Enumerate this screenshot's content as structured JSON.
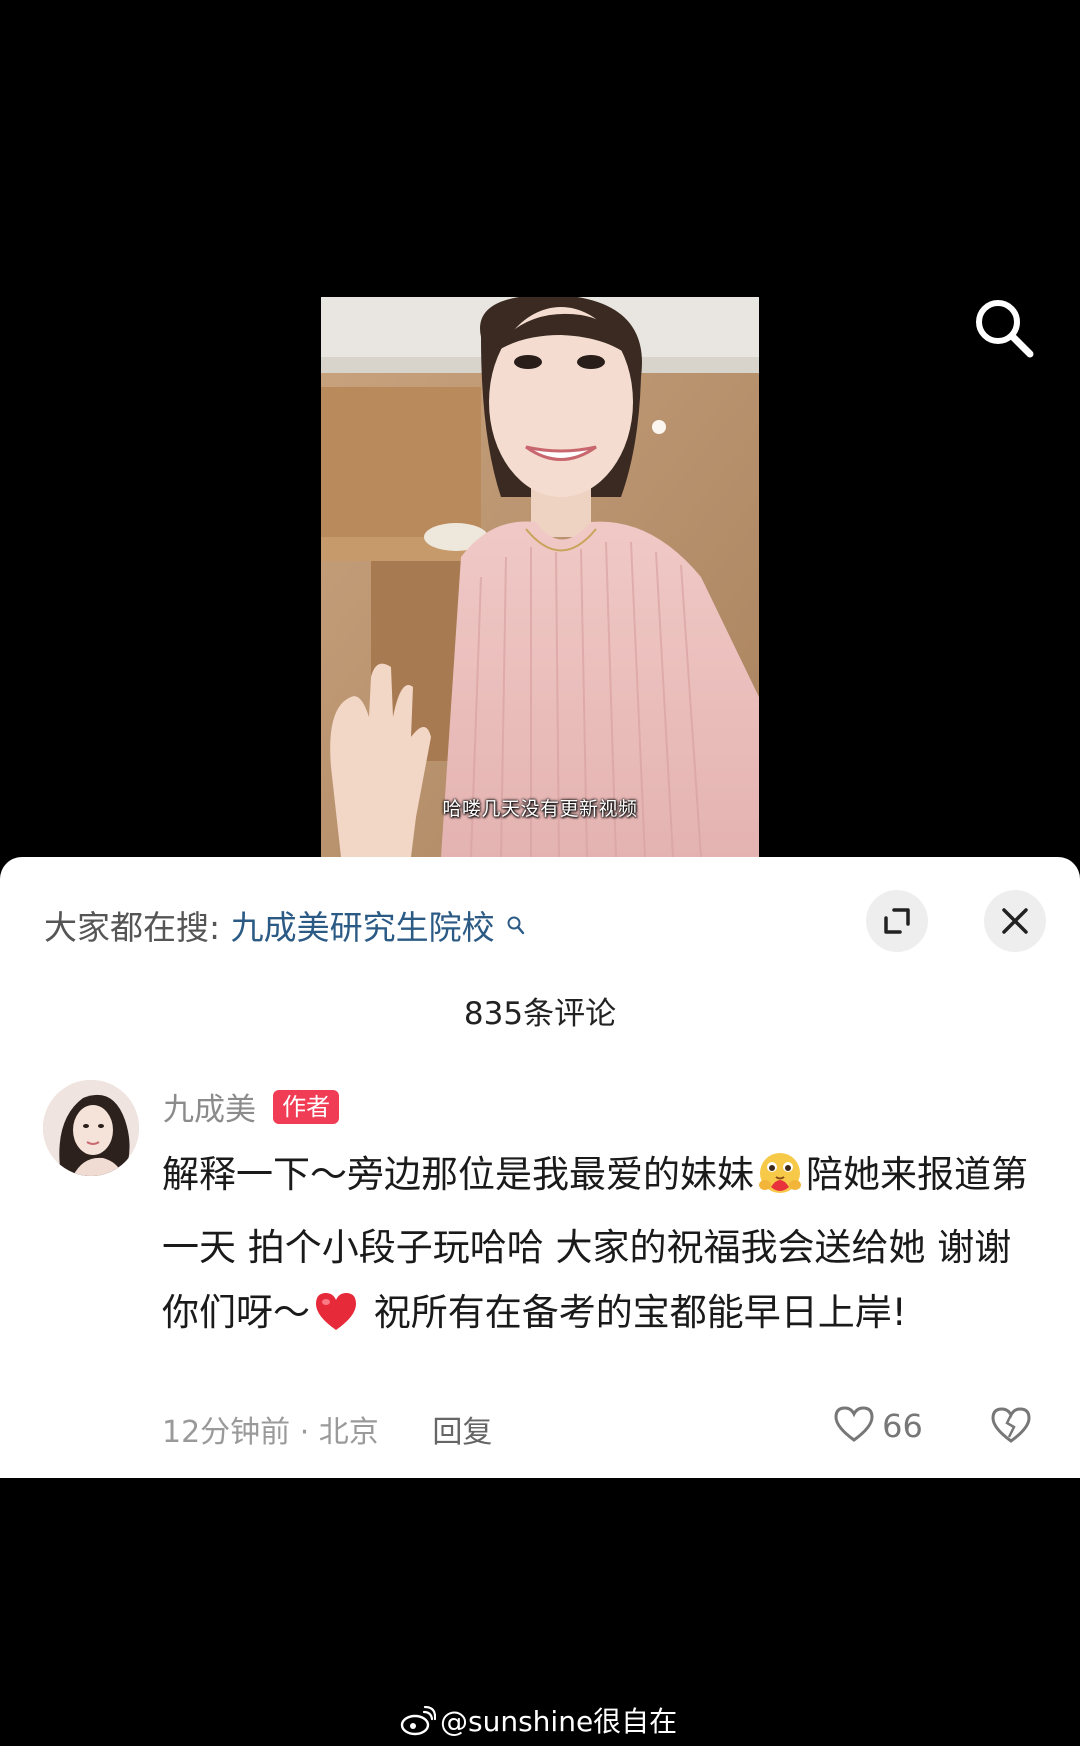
{
  "video": {
    "subtitle": "哈喽几天没有更新视频"
  },
  "icons": {
    "search": "search-icon",
    "expand": "expand-icon",
    "close": "close-icon",
    "like": "heart-outline-icon",
    "dislike": "broken-heart-outline-icon",
    "weibo": "weibo-logo-icon"
  },
  "hot_search": {
    "label": "大家都在搜:",
    "term": "九成美研究生院校"
  },
  "comments_header": {
    "count_text": "835条评论"
  },
  "comment": {
    "author": "九成美",
    "badge": "作者",
    "text_part1": "解释一下～旁边那位是我最爱的妹妹",
    "text_part2": "陪她来报道第一天 拍个小段子玩哈哈 大家的祝福我会送给她 谢谢你们呀～",
    "text_part3": " 祝所有在备考的宝都能早日上岸!",
    "emoji_1": "hugging-face-emoji",
    "emoji_2": "red-heart-emoji",
    "time_location": "12分钟前 · 北京",
    "reply_label": "回复",
    "likes": "66"
  },
  "watermark": {
    "text": "@sunshine很自在"
  },
  "colors": {
    "badge": "#f03c54",
    "link": "#2b5a85",
    "background": "#000000"
  }
}
